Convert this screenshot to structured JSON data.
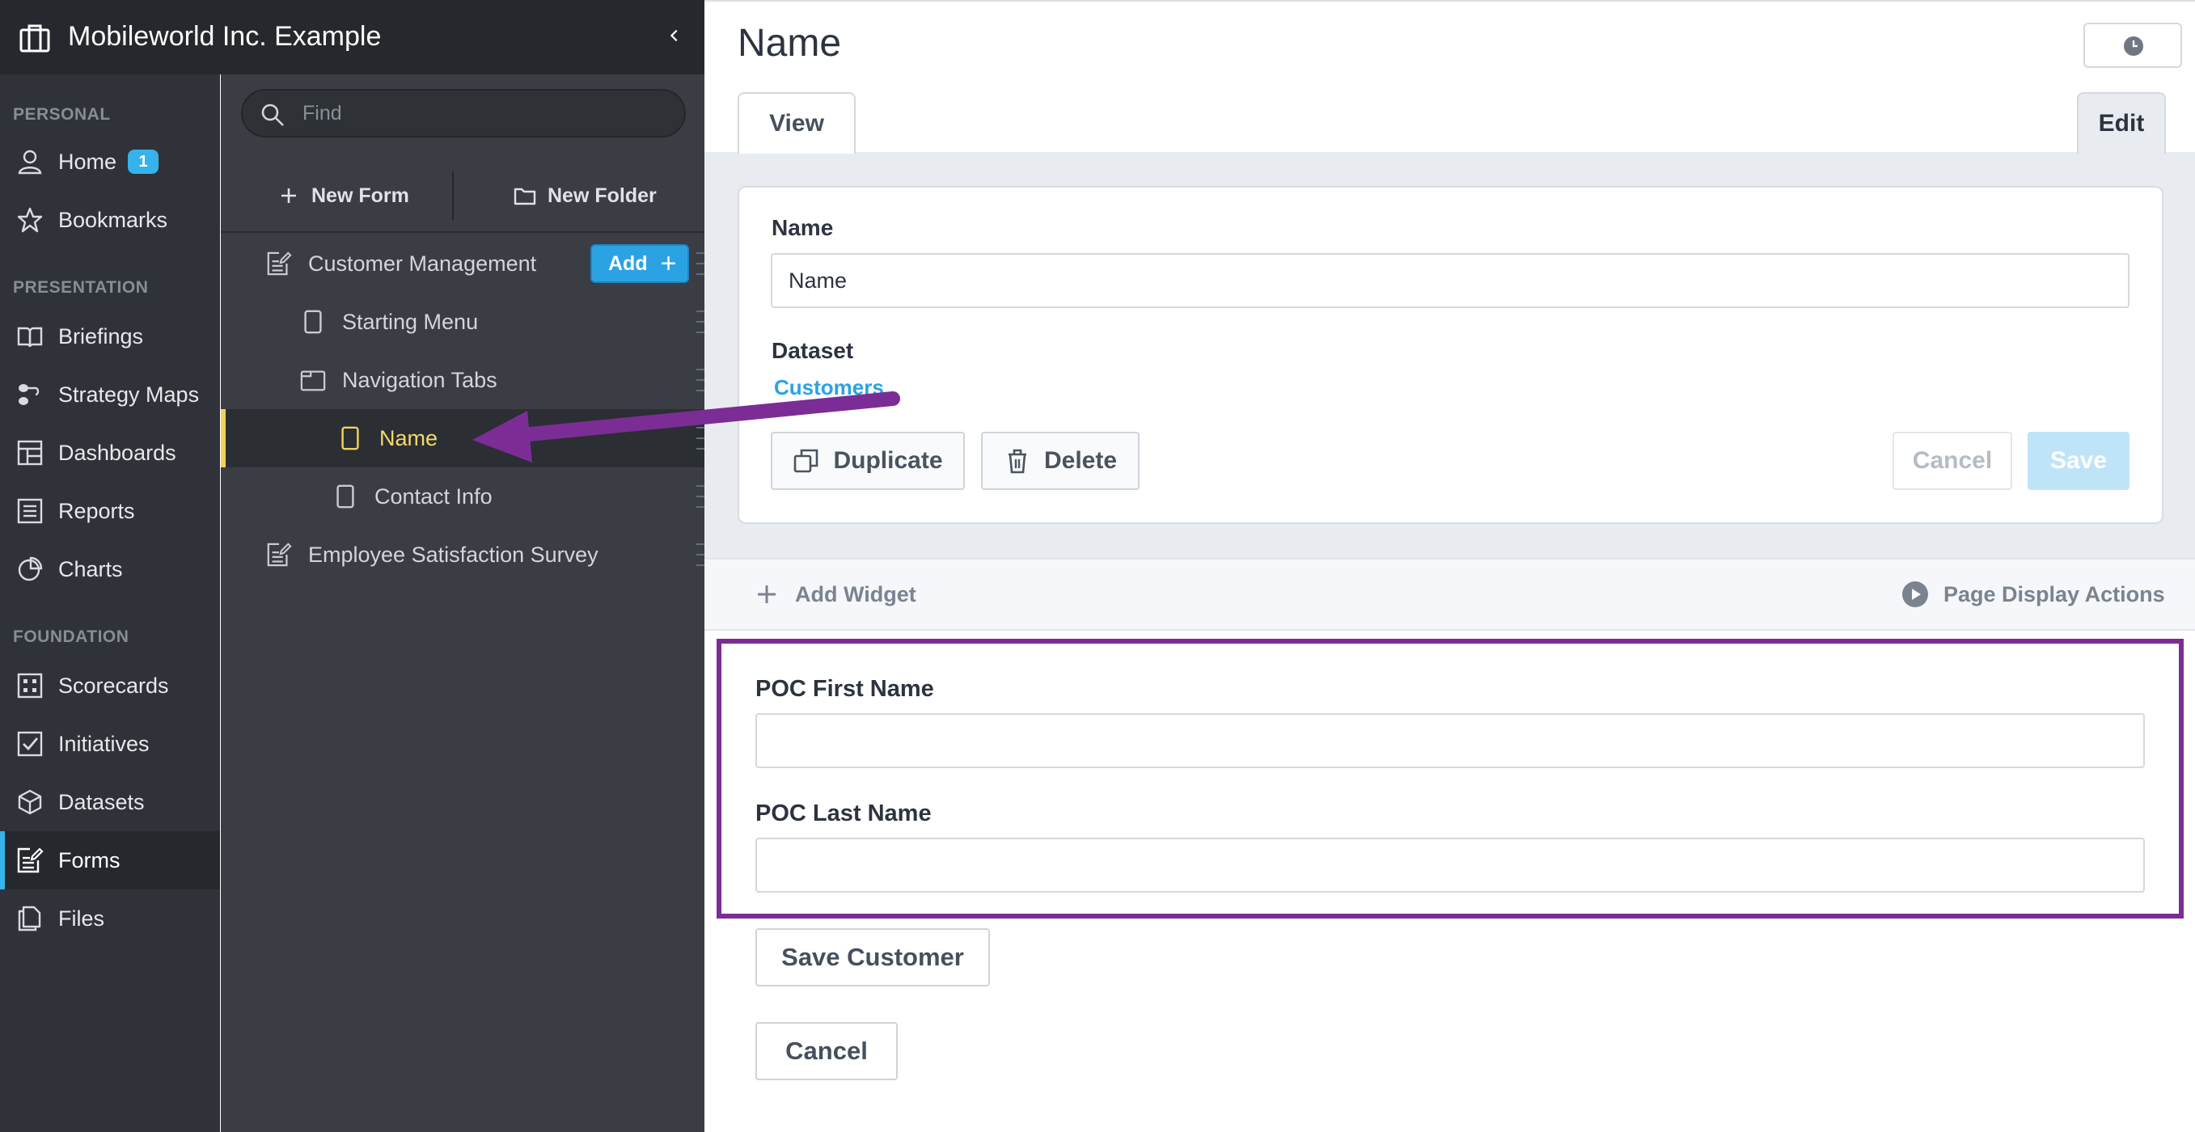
{
  "app": {
    "title": "Mobileworld Inc. Example"
  },
  "sidebar": {
    "sections": [
      {
        "label": "PERSONAL"
      },
      {
        "label": "PRESENTATION"
      },
      {
        "label": "FOUNDATION"
      }
    ],
    "items": [
      {
        "label": "Home",
        "icon": "user-icon",
        "badge": "1"
      },
      {
        "label": "Bookmarks",
        "icon": "star-icon"
      },
      {
        "label": "Briefings",
        "icon": "book-icon"
      },
      {
        "label": "Strategy Maps",
        "icon": "strategy-map-icon"
      },
      {
        "label": "Dashboards",
        "icon": "dashboard-icon"
      },
      {
        "label": "Reports",
        "icon": "report-icon"
      },
      {
        "label": "Charts",
        "icon": "pie-chart-icon"
      },
      {
        "label": "Scorecards",
        "icon": "scorecard-icon"
      },
      {
        "label": "Initiatives",
        "icon": "checkbox-icon"
      },
      {
        "label": "Datasets",
        "icon": "cube-icon"
      },
      {
        "label": "Forms",
        "icon": "form-icon",
        "active": true
      },
      {
        "label": "Files",
        "icon": "files-icon"
      }
    ],
    "active_color": "#35b3ea"
  },
  "panel": {
    "search": {
      "placeholder": "Find"
    },
    "new_form_label": "New Form",
    "new_folder_label": "New Folder",
    "add_label": "Add",
    "tree": [
      {
        "label": "Customer Management",
        "icon": "form-icon"
      },
      {
        "label": "Starting Menu",
        "icon": "page-icon"
      },
      {
        "label": "Navigation Tabs",
        "icon": "tabs-icon"
      },
      {
        "label": "Name",
        "icon": "page-icon",
        "selected": true
      },
      {
        "label": "Contact Info",
        "icon": "page-icon"
      },
      {
        "label": "Employee Satisfaction Survey",
        "icon": "form-icon"
      }
    ],
    "selected_color": "#f4d05b"
  },
  "main": {
    "title": "Name",
    "tabs": [
      {
        "label": "View"
      },
      {
        "label": "Edit"
      }
    ],
    "form": {
      "name_label": "Name",
      "name_value": "Name",
      "dataset_label": "Dataset",
      "dataset_link": "Customers",
      "duplicate_label": "Duplicate",
      "delete_label": "Delete",
      "cancel_label": "Cancel",
      "save_label": "Save"
    },
    "widget_bar": {
      "add_widget_label": "Add Widget",
      "page_display_actions_label": "Page Display Actions"
    },
    "fields": [
      {
        "label": "POC First Name",
        "value": ""
      },
      {
        "label": "POC Last Name",
        "value": ""
      }
    ],
    "save_customer_label": "Save Customer",
    "cancel_label": "Cancel",
    "annotation_color": "#7b2d95",
    "link_color": "#2ba3e3"
  }
}
